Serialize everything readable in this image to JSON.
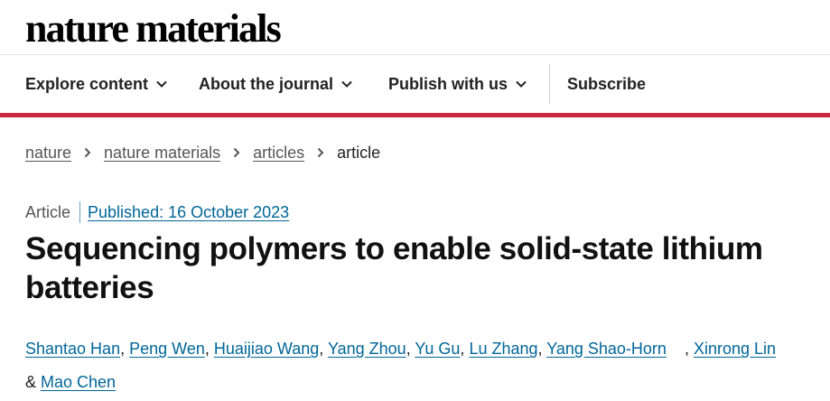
{
  "brand": {
    "logo": "nature materials"
  },
  "nav": {
    "items": [
      {
        "label": "Explore content"
      },
      {
        "label": "About the journal"
      },
      {
        "label": "Publish with us"
      },
      {
        "label": "Subscribe"
      }
    ]
  },
  "breadcrumb": {
    "items": [
      "nature",
      "nature materials",
      "articles"
    ],
    "current": "article"
  },
  "article": {
    "type": "Article",
    "published": "Published: 16 October 2023",
    "title": "Sequencing polymers to enable solid-state lithium batteries",
    "authors": [
      "Shantao Han",
      "Peng Wen",
      "Huaijiao Wang",
      "Yang Zhou",
      "Yu Gu",
      "Lu Zhang",
      "Yang Shao-Horn",
      "Xinrong Lin",
      "Mao Chen"
    ],
    "separator": ", ",
    "conjunction": "& "
  },
  "colors": {
    "accent_red": "#c9283e",
    "link_blue": "#006699"
  },
  "icons": {
    "nav_chevron": "chevron-down-icon",
    "breadcrumb_chevron": "chevron-right-icon"
  }
}
